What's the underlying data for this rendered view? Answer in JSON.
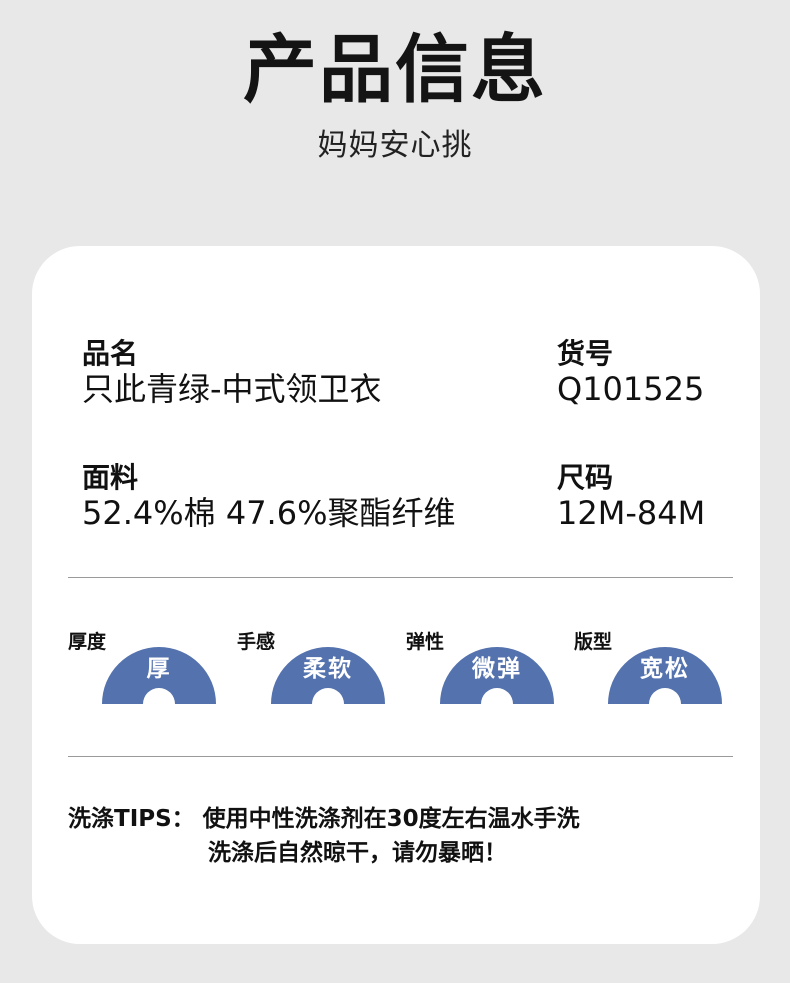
{
  "header": {
    "title": "产品信息",
    "subtitle": "妈妈安心挑"
  },
  "info": {
    "name_label": "品名",
    "name_value": "只此青绿-中式领卫衣",
    "sku_label": "货号",
    "sku_value": "Q101525",
    "fabric_label": "面料",
    "fabric_value": "52.4%棉  47.6%聚酯纤维",
    "size_label": "尺码",
    "size_value": "12M-84M"
  },
  "attributes": [
    {
      "label": "厚度",
      "value": "厚"
    },
    {
      "label": "手感",
      "value": "柔软"
    },
    {
      "label": "弹性",
      "value": "微弹"
    },
    {
      "label": "版型",
      "value": "宽松"
    }
  ],
  "tips": {
    "label": "洗涤TIPS：",
    "line1": "使用中性洗涤剂在30度左右温水手洗",
    "line2": "洗涤后自然晾干，请勿暴晒！"
  },
  "colors": {
    "badge": "#5472ad",
    "background": "#e8e8e8",
    "card": "#ffffff"
  }
}
